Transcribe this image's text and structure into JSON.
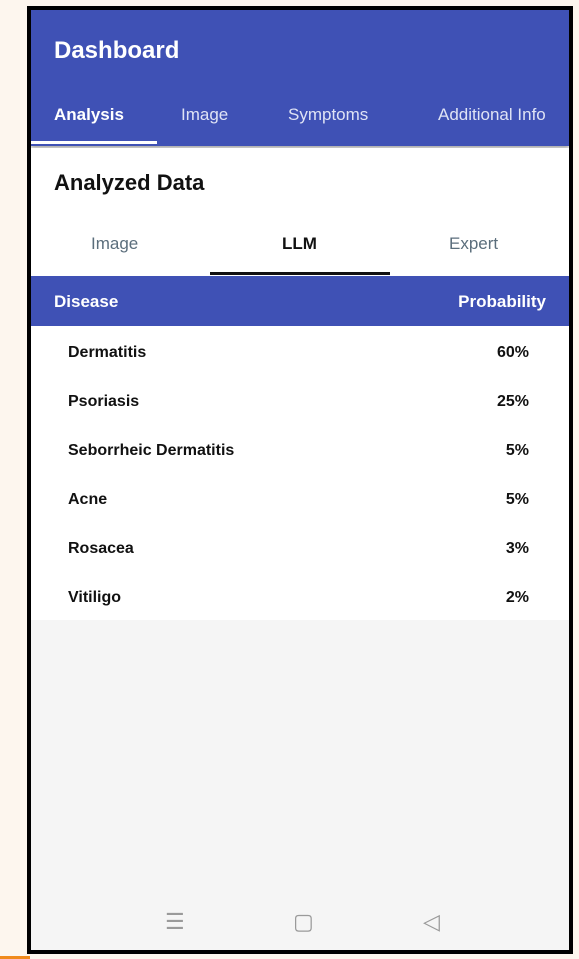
{
  "header": {
    "title": "Dashboard"
  },
  "main_tabs": [
    {
      "label": "Analysis"
    },
    {
      "label": "Image"
    },
    {
      "label": "Symptoms"
    },
    {
      "label": "Additional Info"
    }
  ],
  "section": {
    "title": "Analyzed Data"
  },
  "sub_tabs": [
    {
      "label": "Image"
    },
    {
      "label": "LLM"
    },
    {
      "label": "Expert"
    }
  ],
  "table": {
    "headers": {
      "disease": "Disease",
      "probability": "Probability"
    },
    "rows": [
      {
        "disease": "Dermatitis",
        "probability": "60%"
      },
      {
        "disease": "Psoriasis",
        "probability": "25%"
      },
      {
        "disease": "Seborrheic Dermatitis",
        "probability": "5%"
      },
      {
        "disease": "Acne",
        "probability": "5%"
      },
      {
        "disease": "Rosacea",
        "probability": "3%"
      },
      {
        "disease": "Vitiligo",
        "probability": "2%"
      }
    ]
  },
  "nav": {
    "menu": "☰",
    "home": "▢",
    "back": "◁"
  },
  "colors": {
    "primary": "#3f51b5",
    "accent_text": "#5b6e7c"
  }
}
